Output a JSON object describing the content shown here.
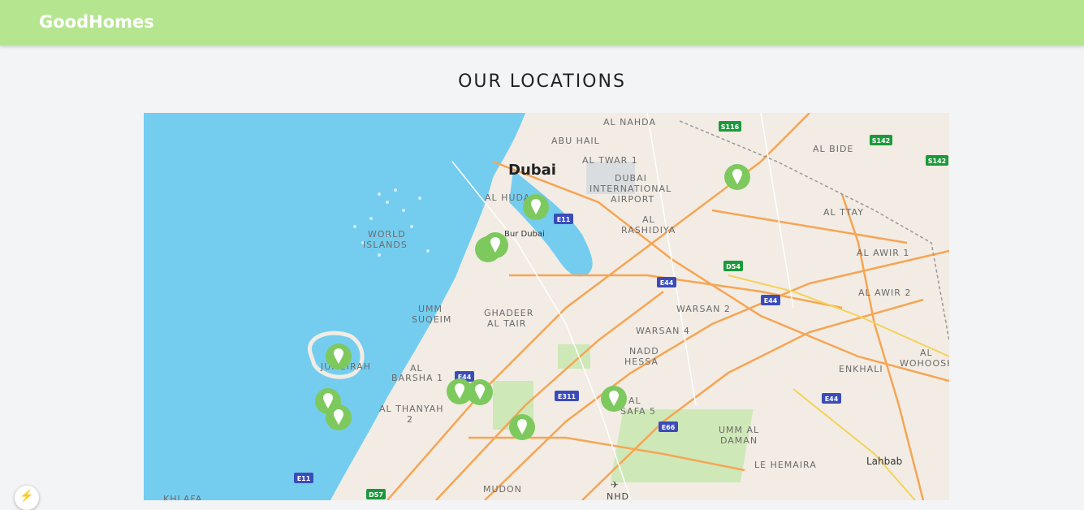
{
  "header": {
    "brand": "GoodHomes"
  },
  "main": {
    "title": "OUR LOCATIONS"
  },
  "map": {
    "labels": [
      {
        "id": "dubai",
        "text": "Dubai"
      },
      {
        "id": "bur-dubai",
        "text": "Bur Dubai"
      },
      {
        "id": "al-nahda",
        "text": "AL NAHDA"
      },
      {
        "id": "abu-hail",
        "text": "ABU HAIL"
      },
      {
        "id": "al-twar",
        "text": "AL TWAR 1"
      },
      {
        "id": "airport1",
        "text": "DUBAI"
      },
      {
        "id": "airport2",
        "text": "INTERNATIONAL"
      },
      {
        "id": "airport3",
        "text": "AIRPORT"
      },
      {
        "id": "al-hud",
        "text": "AL HUDA"
      },
      {
        "id": "al-rash1",
        "text": "AL"
      },
      {
        "id": "al-rash2",
        "text": "RASHIDIYA"
      },
      {
        "id": "world1",
        "text": "WORLD"
      },
      {
        "id": "world2",
        "text": "ISLANDS"
      },
      {
        "id": "al-bidea",
        "text": "AL BIDE"
      },
      {
        "id": "al-ttay",
        "text": "AL TTAY"
      },
      {
        "id": "al-awir1",
        "text": "AL AWIR 1"
      },
      {
        "id": "al-awir2",
        "text": "AL AWIR 2"
      },
      {
        "id": "umm1",
        "text": "UMM"
      },
      {
        "id": "umm2",
        "text": "SUQEIM"
      },
      {
        "id": "ghadeer1",
        "text": "GHADEER"
      },
      {
        "id": "ghadeer2",
        "text": "AL TAIR"
      },
      {
        "id": "warsan2",
        "text": "WARSAN 2"
      },
      {
        "id": "warsan4",
        "text": "WARSAN 4"
      },
      {
        "id": "nadd1",
        "text": "NADD"
      },
      {
        "id": "nadd2",
        "text": "HESSA"
      },
      {
        "id": "enkhali",
        "text": "ENKHALI"
      },
      {
        "id": "wohoosh1",
        "text": "AL"
      },
      {
        "id": "wohoosh2",
        "text": "WOHOOSH"
      },
      {
        "id": "jumeirah",
        "text": "JUMEIRAH"
      },
      {
        "id": "barsha1",
        "text": "AL"
      },
      {
        "id": "barsha2",
        "text": "BARSHA 1"
      },
      {
        "id": "thanyah1",
        "text": "AL THANYAH"
      },
      {
        "id": "thanyah2",
        "text": "2"
      },
      {
        "id": "safa1",
        "text": "AL"
      },
      {
        "id": "safa2",
        "text": "SAFA 5"
      },
      {
        "id": "ummdaman1",
        "text": "UMM AL"
      },
      {
        "id": "ummdaman2",
        "text": "DAMAN"
      },
      {
        "id": "hemaira",
        "text": "LE HEMAIRA"
      },
      {
        "id": "lahbab",
        "text": "Lahbab"
      },
      {
        "id": "mudon",
        "text": "MUDON"
      },
      {
        "id": "nhd",
        "text": "NHD"
      },
      {
        "id": "kuhlafa",
        "text": "KHLAFA"
      }
    ],
    "shields": [
      {
        "id": "s116",
        "text": "S116"
      },
      {
        "id": "s142a",
        "text": "S142"
      },
      {
        "id": "s142b",
        "text": "S142"
      },
      {
        "id": "e11a",
        "text": "E11"
      },
      {
        "id": "d54",
        "text": "D54"
      },
      {
        "id": "e44a",
        "text": "E44"
      },
      {
        "id": "e44b",
        "text": "E44"
      },
      {
        "id": "e44c",
        "text": "E44"
      },
      {
        "id": "e44d",
        "text": "E44"
      },
      {
        "id": "e311",
        "text": "E311"
      },
      {
        "id": "e66",
        "text": "E66"
      },
      {
        "id": "e11b",
        "text": "E11"
      },
      {
        "id": "d57",
        "text": "D57"
      }
    ]
  },
  "colors": {
    "header": "#b5e68f",
    "marker": "#7dc95e",
    "water": "#74cdef",
    "land": "#f2ece4"
  }
}
